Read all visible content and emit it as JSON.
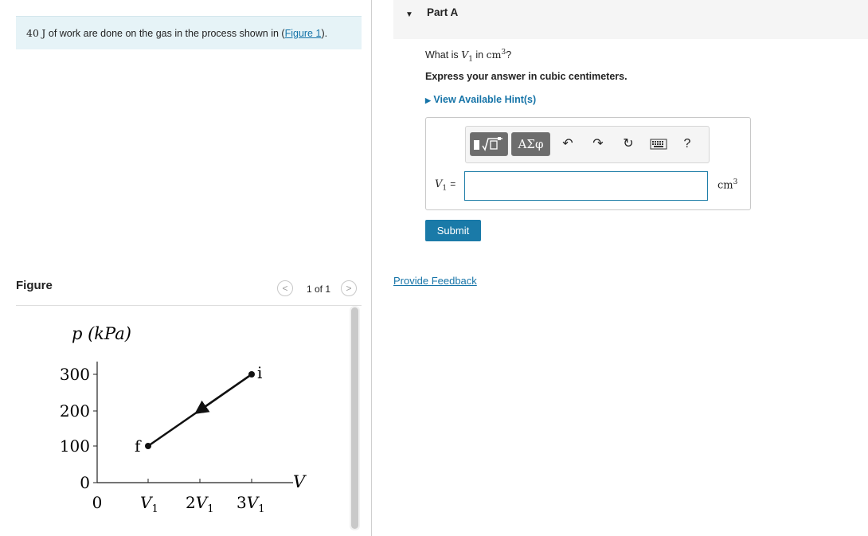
{
  "intro": {
    "number": "40",
    "unit": "J",
    "text": " of work are done on the gas in the process shown in (",
    "link": "Figure 1",
    "tail": ")."
  },
  "figure": {
    "label": "Figure",
    "pager_text": "1 of 1",
    "prev_icon": "chevron-left-icon",
    "next_icon": "chevron-right-icon",
    "y_axis_label": "p (kPa)",
    "x_axis_label": "V",
    "y_ticks": [
      "300",
      "200",
      "100",
      "0"
    ],
    "x_ticks": [
      "0",
      "V",
      "2V",
      "3V"
    ],
    "x_tick_subscripts": [
      "",
      "1",
      "1",
      "1"
    ],
    "point_i_label": "i",
    "point_f_label": "f"
  },
  "part": {
    "title": "Part A",
    "question_prefix": "What is ",
    "question_var": "V",
    "question_var_sub": "1",
    "question_mid": " in ",
    "question_unit": "cm",
    "question_unit_sup": "3",
    "question_suffix": "?",
    "instruction": "Express your answer in cubic centimeters.",
    "hint": "View Available Hint(s)",
    "toolbar": {
      "template_icon": "template-icon",
      "symbols_label": "ΑΣφ",
      "undo_icon": "undo-icon",
      "redo_icon": "redo-icon",
      "reset_icon": "reset-icon",
      "keyboard_icon": "keyboard-icon",
      "help_label": "?"
    },
    "answer_var": "V",
    "answer_var_sub": "1",
    "answer_eq": "=",
    "answer_value": "",
    "answer_unit": "cm",
    "answer_unit_sup": "3",
    "submit_label": "Submit",
    "feedback_label": "Provide Feedback"
  },
  "colors": {
    "accent": "#1a7aa8",
    "link": "#1674a8",
    "intro_bg": "#e6f3f7"
  }
}
